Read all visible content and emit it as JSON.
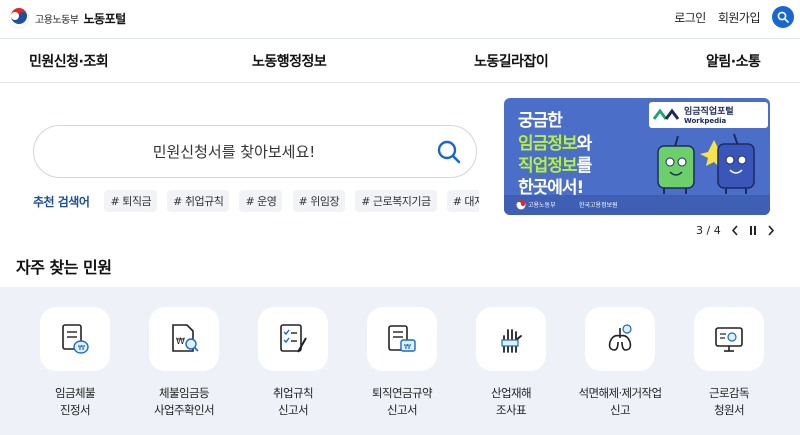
{
  "header": {
    "ministry": "고용노동부",
    "portal": "노동포털",
    "login": "로그인",
    "signup": "회원가입",
    "search_icon": "search-icon"
  },
  "gnb": [
    {
      "label": "민원신청·조회"
    },
    {
      "label": "노동행정정보"
    },
    {
      "label": "노동길라잡이"
    },
    {
      "label": "알림·소통"
    }
  ],
  "search": {
    "placeholder": "민원신청서를 찾아보세요!",
    "recommend_label": "추천 검색어",
    "tags": [
      "# 퇴직금",
      "# 취업규칙",
      "# 운영",
      "# 위임장",
      "# 근로복지기금",
      "# 대지"
    ]
  },
  "banner": {
    "line1": "궁금한",
    "line2a": "임금정보",
    "line2b": "와",
    "line3a": "직업정보",
    "line3b": "를",
    "line4": "한곳에서!",
    "brand_title": "임금직업포털",
    "brand_sub": "Workpedia",
    "footer1": "고용노동부",
    "footer2": "한국고용정보원",
    "highlight_color": "#b7f03b",
    "bg_color": "#4b6fc9"
  },
  "pager": {
    "current": "3",
    "sep": "/",
    "total": "4"
  },
  "frequent": {
    "title": "자주 찾는 민원",
    "items": [
      {
        "line1": "임금체불",
        "line2": "진정서",
        "icon": "wage-complaint-icon"
      },
      {
        "line1": "체불임금등",
        "line2": "사업주확인서",
        "icon": "unpaid-wage-confirm-icon"
      },
      {
        "line1": "취업규칙",
        "line2": "신고서",
        "icon": "work-rules-icon"
      },
      {
        "line1": "퇴직연금규약",
        "line2": "신고서",
        "icon": "retirement-pension-icon"
      },
      {
        "line1": "산업재해",
        "line2": "조사표",
        "icon": "industrial-accident-icon"
      },
      {
        "line1": "석면해제·제거작업",
        "line2": "신고",
        "icon": "asbestos-removal-icon"
      },
      {
        "line1": "근로감독",
        "line2": "청원서",
        "icon": "labor-inspection-icon"
      }
    ]
  }
}
